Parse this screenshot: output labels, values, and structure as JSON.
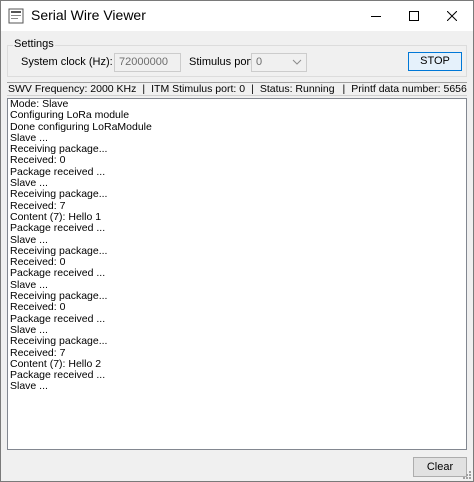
{
  "window": {
    "title": "Serial Wire Viewer",
    "icon": "app-icon",
    "controls": [
      "minimize-icon",
      "maximize-icon",
      "close-icon"
    ]
  },
  "settings": {
    "group_label": "Settings",
    "system_clock_label": "System clock (Hz):",
    "system_clock_value": "72000000",
    "stimulus_port_label": "Stimulus port:",
    "stimulus_port_value": "0",
    "stop_label": "STOP"
  },
  "status": {
    "swv_frequency": "SWV Frequency: 2000 KHz",
    "itm_port": "ITM Stimulus port: 0",
    "state": "Status: Running",
    "printf_count": "Printf data number: 5656",
    "separator": "|"
  },
  "log": {
    "lines": [
      "Mode: Slave",
      "Configuring LoRa module",
      "Done configuring LoRaModule",
      "Slave ...",
      "Receiving package...",
      "Received: 0",
      "Package received ...",
      "Slave ...",
      "Receiving package...",
      "Received: 7",
      "Content (7): Hello 1",
      "Package received ...",
      "Slave ...",
      "Receiving package...",
      "Received: 0",
      "Package received ...",
      "Slave ...",
      "Receiving package...",
      "Received: 0",
      "Package received ...",
      "Slave ...",
      "Receiving package...",
      "Received: 7",
      "Content (7): Hello 2",
      "Package received ...",
      "Slave ..."
    ]
  },
  "footer": {
    "clear_label": "Clear"
  },
  "colors": {
    "accent": "#0078d7",
    "window_bg": "#f0f0f0",
    "titlebar_bg": "#ffffff"
  }
}
